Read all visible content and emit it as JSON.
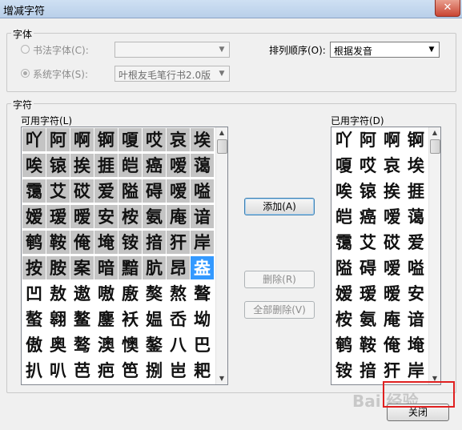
{
  "window": {
    "title": "增减字符",
    "close_glyph": "✕"
  },
  "font_group": {
    "label": "字体",
    "calligraphy_font": {
      "label": "书法字体(C):",
      "value": "",
      "checked": false,
      "enabled": false
    },
    "system_font": {
      "label": "系统字体(S):",
      "value": "叶根友毛笔行书2.0版",
      "checked": true,
      "enabled": false
    },
    "sort_order": {
      "label": "排列顺序(O):",
      "value": "根据发音"
    }
  },
  "char_group": {
    "label": "字符",
    "available": {
      "label": "可用字符(L)",
      "rows": [
        [
          "吖",
          "阿",
          "啊",
          "锕",
          "嗄",
          "哎",
          "哀",
          "埃"
        ],
        [
          "唉",
          "锿",
          "挨",
          "捱",
          "皑",
          "癌",
          "嗳",
          "蔼"
        ],
        [
          "霭",
          "艾",
          "砹",
          "爱",
          "隘",
          "碍",
          "嗳",
          "嗌"
        ],
        [
          "嫒",
          "瑷",
          "暧",
          "安",
          "桉",
          "氨",
          "庵",
          "谙"
        ],
        [
          "鹌",
          "鞍",
          "俺",
          "埯",
          "铵",
          "揞",
          "犴",
          "岸"
        ],
        [
          "按",
          "胺",
          "案",
          "暗",
          "黯",
          "肮",
          "昂",
          "盎"
        ],
        [
          "凹",
          "敖",
          "遨",
          "嗷",
          "廒",
          "獒",
          "熬",
          "聱"
        ],
        [
          "螯",
          "翱",
          "鳌",
          "鏖",
          "袄",
          "媪",
          "岙",
          "坳"
        ],
        [
          "傲",
          "奥",
          "骜",
          "澳",
          "懊",
          "鏊",
          "八",
          "巴"
        ],
        [
          "扒",
          "叭",
          "芭",
          "疤",
          "笆",
          "捌",
          "岜",
          "耙"
        ]
      ],
      "added_rows": 6,
      "selected": "盎"
    },
    "used": {
      "label": "已用字符(D)",
      "rows": [
        [
          "吖",
          "阿",
          "啊",
          "锕"
        ],
        [
          "嗄",
          "哎",
          "哀",
          "埃"
        ],
        [
          "唉",
          "锿",
          "挨",
          "捱"
        ],
        [
          "皑",
          "癌",
          "嗳",
          "蔼"
        ],
        [
          "霭",
          "艾",
          "砹",
          "爱"
        ],
        [
          "隘",
          "碍",
          "嗳",
          "嗌"
        ],
        [
          "嫒",
          "瑷",
          "暧",
          "安"
        ],
        [
          "桉",
          "氨",
          "庵",
          "谙"
        ],
        [
          "鹌",
          "鞍",
          "俺",
          "埯"
        ],
        [
          "铵",
          "揞",
          "犴",
          "岸"
        ]
      ]
    },
    "buttons": {
      "add": "添加(A)",
      "delete": "删除(R)",
      "delete_all": "全部删除(V)"
    }
  },
  "footer": {
    "close": "关闭"
  },
  "watermark": "Bai 经验",
  "colors": {
    "selected_cell": "#3399ff",
    "added_cell": "#c4c4c4",
    "highlight_box": "#e02020"
  }
}
